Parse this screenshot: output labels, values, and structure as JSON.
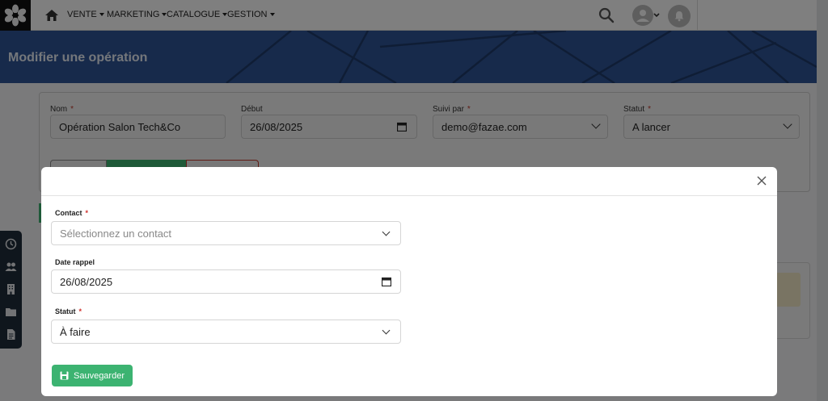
{
  "nav": {
    "menu": [
      {
        "label": "VENTE"
      },
      {
        "label": "MARKETING"
      },
      {
        "label": "CATALOGUE"
      },
      {
        "label": "GESTION"
      }
    ]
  },
  "header": {
    "title": "Modifier une opération"
  },
  "form": {
    "nom": {
      "label": "Nom",
      "value": "Opération Salon Tech&Co"
    },
    "debut": {
      "label": "Début",
      "value": "26/08/2025"
    },
    "suivi_par": {
      "label": "Suivi par",
      "value": "demo@fazae.com"
    },
    "statut": {
      "label": "Statut",
      "value": "A lancer"
    },
    "required_mark": "*"
  },
  "modal": {
    "contact": {
      "label": "Contact",
      "placeholder": "Sélectionnez un contact"
    },
    "date_rappel": {
      "label": "Date rappel",
      "value": "26/08/2025"
    },
    "statut": {
      "label": "Statut",
      "value": "À faire"
    },
    "required_mark": "*",
    "save_label": "Sauvegarder"
  },
  "colors": {
    "banner": "#2f5597",
    "accent_green": "#3cb371",
    "required": "#d0312d",
    "sidebar": "#1f2d3a"
  },
  "icons": {
    "logo": "flower-logo-icon",
    "home": "home-icon",
    "search": "search-icon",
    "user": "user-avatar-icon",
    "bell": "bell-icon",
    "close": "close-icon",
    "save": "floppy-disk-icon",
    "sidebar": [
      "clock-icon",
      "users-icon",
      "building-icon",
      "folder-icon",
      "document-icon"
    ]
  }
}
